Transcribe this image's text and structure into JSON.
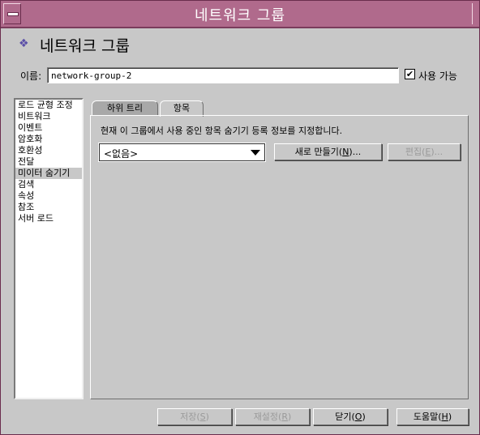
{
  "window": {
    "title": "네트워크 그룹"
  },
  "heading": {
    "icon": "diamond-icon",
    "text": "네트워크 그룹"
  },
  "name": {
    "label": "이름:",
    "value": "network-group-2"
  },
  "enabled": {
    "label": "사용 가능",
    "checked": true
  },
  "nav": {
    "items": [
      "로드 균형 조정",
      "비트워크",
      "이벤트",
      "암호화",
      "호환성",
      "전달",
      "미이터 숨기기",
      "검색",
      "속성",
      "참조",
      "서버 로드"
    ],
    "selected_index": 6
  },
  "tabs": [
    {
      "label": "하위 트리",
      "active": false
    },
    {
      "label": "항목",
      "active": true
    }
  ],
  "panel": {
    "description": "현재 이 그룹에서 사용 중인 항목 숨기기 등록 정보를 지정합니다.",
    "select_value": "<없음>",
    "new_button": {
      "pre": "새로 만들기(",
      "key": "N",
      "post": ")..."
    },
    "edit_button": {
      "pre": "편집(",
      "key": "E",
      "post": ")..."
    }
  },
  "footer": {
    "save": {
      "pre": "저장(",
      "key": "S",
      "post": ")"
    },
    "reset": {
      "pre": "재설정(",
      "key": "R",
      "post": ")"
    },
    "close": {
      "pre": "닫기(",
      "key": "O",
      "post": ")"
    },
    "help": {
      "pre": "도움말(",
      "key": "H",
      "post": ")"
    }
  }
}
